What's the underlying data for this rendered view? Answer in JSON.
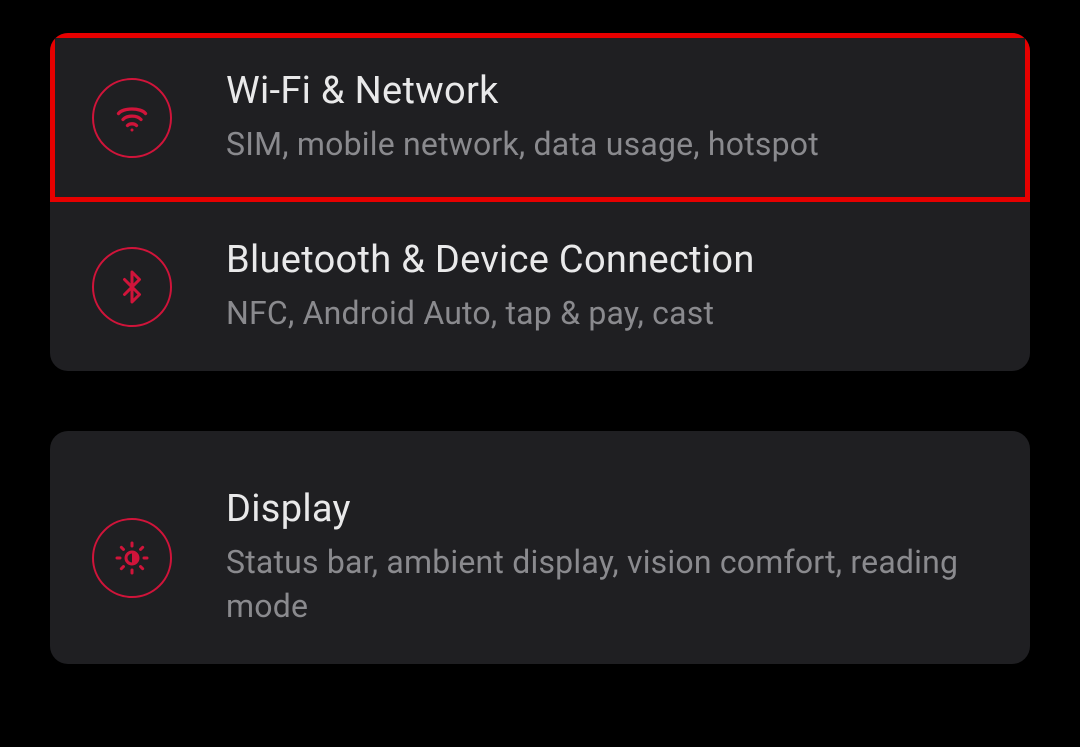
{
  "colors": {
    "accent": "#d0143a",
    "highlight_border": "#e60000",
    "card_bg": "#1f1f22",
    "title": "#e9e9ea",
    "subtitle": "#8a8a8e"
  },
  "groups": [
    {
      "items": [
        {
          "icon": "wifi-icon",
          "title": "Wi-Fi & Network",
          "subtitle": "SIM, mobile network, data usage, hotspot",
          "highlighted": true
        },
        {
          "icon": "bluetooth-icon",
          "title": "Bluetooth & Device Connection",
          "subtitle": "NFC, Android Auto, tap & pay, cast",
          "highlighted": false
        }
      ]
    },
    {
      "items": [
        {
          "icon": "brightness-icon",
          "title": "Display",
          "subtitle": "Status bar, ambient display, vision comfort, reading mode",
          "highlighted": false
        }
      ]
    }
  ]
}
